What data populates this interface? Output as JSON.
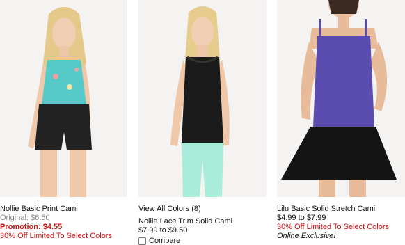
{
  "products": [
    {
      "name": "Nollie Basic Print Cami",
      "original": "Original: $6.50",
      "promotion": "Promotion: $4.55",
      "deal": "30% Off Limited To Select Colors"
    },
    {
      "colors_link": "View All Colors (8)",
      "name": "Nollie Lace Trim Solid Cami",
      "price": "$7.99 to $9.50",
      "compare_label": "Compare"
    },
    {
      "name": "Lilu Basic Solid Stretch Cami",
      "price": "$4.99 to $7.99",
      "deal": "30% Off Limited To Select Colors",
      "exclusive": "Online Exclusive!"
    }
  ],
  "colors": {
    "promo_red": "#cc1111",
    "muted_gray": "#888888",
    "cami_teal": "#56c9c9",
    "cami_black": "#1a1a1a",
    "cami_purple": "#5b4db0",
    "jeans_mint": "#a8ecd9"
  }
}
